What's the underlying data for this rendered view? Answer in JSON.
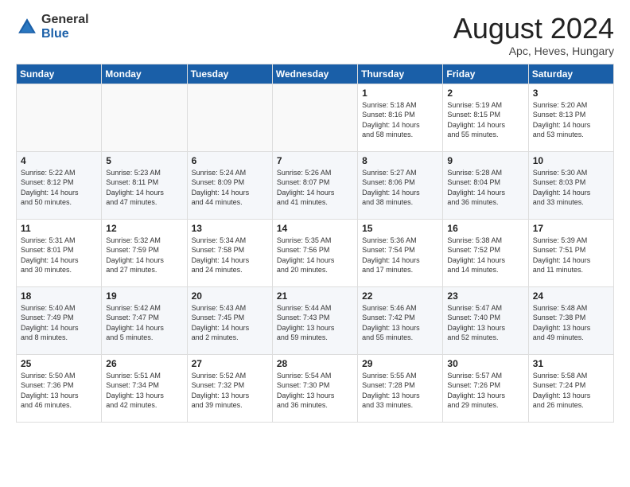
{
  "header": {
    "logo_general": "General",
    "logo_blue": "Blue",
    "main_title": "August 2024",
    "subtitle": "Apc, Heves, Hungary"
  },
  "calendar": {
    "days_of_week": [
      "Sunday",
      "Monday",
      "Tuesday",
      "Wednesday",
      "Thursday",
      "Friday",
      "Saturday"
    ],
    "weeks": [
      [
        {
          "day": "",
          "content": ""
        },
        {
          "day": "",
          "content": ""
        },
        {
          "day": "",
          "content": ""
        },
        {
          "day": "",
          "content": ""
        },
        {
          "day": "1",
          "content": "Sunrise: 5:18 AM\nSunset: 8:16 PM\nDaylight: 14 hours\nand 58 minutes."
        },
        {
          "day": "2",
          "content": "Sunrise: 5:19 AM\nSunset: 8:15 PM\nDaylight: 14 hours\nand 55 minutes."
        },
        {
          "day": "3",
          "content": "Sunrise: 5:20 AM\nSunset: 8:13 PM\nDaylight: 14 hours\nand 53 minutes."
        }
      ],
      [
        {
          "day": "4",
          "content": "Sunrise: 5:22 AM\nSunset: 8:12 PM\nDaylight: 14 hours\nand 50 minutes."
        },
        {
          "day": "5",
          "content": "Sunrise: 5:23 AM\nSunset: 8:11 PM\nDaylight: 14 hours\nand 47 minutes."
        },
        {
          "day": "6",
          "content": "Sunrise: 5:24 AM\nSunset: 8:09 PM\nDaylight: 14 hours\nand 44 minutes."
        },
        {
          "day": "7",
          "content": "Sunrise: 5:26 AM\nSunset: 8:07 PM\nDaylight: 14 hours\nand 41 minutes."
        },
        {
          "day": "8",
          "content": "Sunrise: 5:27 AM\nSunset: 8:06 PM\nDaylight: 14 hours\nand 38 minutes."
        },
        {
          "day": "9",
          "content": "Sunrise: 5:28 AM\nSunset: 8:04 PM\nDaylight: 14 hours\nand 36 minutes."
        },
        {
          "day": "10",
          "content": "Sunrise: 5:30 AM\nSunset: 8:03 PM\nDaylight: 14 hours\nand 33 minutes."
        }
      ],
      [
        {
          "day": "11",
          "content": "Sunrise: 5:31 AM\nSunset: 8:01 PM\nDaylight: 14 hours\nand 30 minutes."
        },
        {
          "day": "12",
          "content": "Sunrise: 5:32 AM\nSunset: 7:59 PM\nDaylight: 14 hours\nand 27 minutes."
        },
        {
          "day": "13",
          "content": "Sunrise: 5:34 AM\nSunset: 7:58 PM\nDaylight: 14 hours\nand 24 minutes."
        },
        {
          "day": "14",
          "content": "Sunrise: 5:35 AM\nSunset: 7:56 PM\nDaylight: 14 hours\nand 20 minutes."
        },
        {
          "day": "15",
          "content": "Sunrise: 5:36 AM\nSunset: 7:54 PM\nDaylight: 14 hours\nand 17 minutes."
        },
        {
          "day": "16",
          "content": "Sunrise: 5:38 AM\nSunset: 7:52 PM\nDaylight: 14 hours\nand 14 minutes."
        },
        {
          "day": "17",
          "content": "Sunrise: 5:39 AM\nSunset: 7:51 PM\nDaylight: 14 hours\nand 11 minutes."
        }
      ],
      [
        {
          "day": "18",
          "content": "Sunrise: 5:40 AM\nSunset: 7:49 PM\nDaylight: 14 hours\nand 8 minutes."
        },
        {
          "day": "19",
          "content": "Sunrise: 5:42 AM\nSunset: 7:47 PM\nDaylight: 14 hours\nand 5 minutes."
        },
        {
          "day": "20",
          "content": "Sunrise: 5:43 AM\nSunset: 7:45 PM\nDaylight: 14 hours\nand 2 minutes."
        },
        {
          "day": "21",
          "content": "Sunrise: 5:44 AM\nSunset: 7:43 PM\nDaylight: 13 hours\nand 59 minutes."
        },
        {
          "day": "22",
          "content": "Sunrise: 5:46 AM\nSunset: 7:42 PM\nDaylight: 13 hours\nand 55 minutes."
        },
        {
          "day": "23",
          "content": "Sunrise: 5:47 AM\nSunset: 7:40 PM\nDaylight: 13 hours\nand 52 minutes."
        },
        {
          "day": "24",
          "content": "Sunrise: 5:48 AM\nSunset: 7:38 PM\nDaylight: 13 hours\nand 49 minutes."
        }
      ],
      [
        {
          "day": "25",
          "content": "Sunrise: 5:50 AM\nSunset: 7:36 PM\nDaylight: 13 hours\nand 46 minutes."
        },
        {
          "day": "26",
          "content": "Sunrise: 5:51 AM\nSunset: 7:34 PM\nDaylight: 13 hours\nand 42 minutes."
        },
        {
          "day": "27",
          "content": "Sunrise: 5:52 AM\nSunset: 7:32 PM\nDaylight: 13 hours\nand 39 minutes."
        },
        {
          "day": "28",
          "content": "Sunrise: 5:54 AM\nSunset: 7:30 PM\nDaylight: 13 hours\nand 36 minutes."
        },
        {
          "day": "29",
          "content": "Sunrise: 5:55 AM\nSunset: 7:28 PM\nDaylight: 13 hours\nand 33 minutes."
        },
        {
          "day": "30",
          "content": "Sunrise: 5:57 AM\nSunset: 7:26 PM\nDaylight: 13 hours\nand 29 minutes."
        },
        {
          "day": "31",
          "content": "Sunrise: 5:58 AM\nSunset: 7:24 PM\nDaylight: 13 hours\nand 26 minutes."
        }
      ]
    ]
  }
}
